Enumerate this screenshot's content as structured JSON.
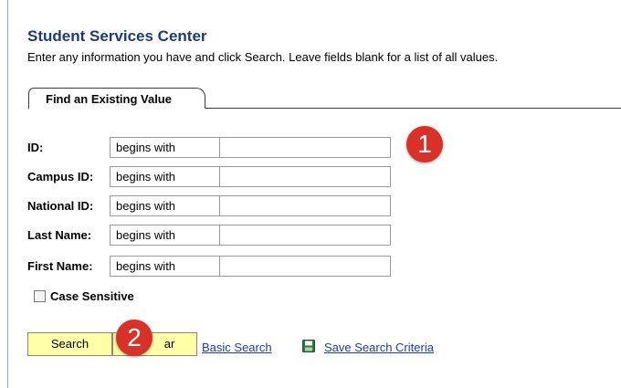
{
  "header": {
    "title": "Student Services Center",
    "subtitle": "Enter any information you have and click Search. Leave fields blank for a list of all values."
  },
  "tab": {
    "label": "Find an Existing Value"
  },
  "fields": [
    {
      "label": "ID:",
      "operator": "begins with",
      "value": ""
    },
    {
      "label": "Campus ID:",
      "operator": "begins with",
      "value": ""
    },
    {
      "label": "National ID:",
      "operator": "begins with",
      "value": ""
    },
    {
      "label": "Last Name:",
      "operator": "begins with",
      "value": ""
    },
    {
      "label": "First Name:",
      "operator": "begins with",
      "value": ""
    }
  ],
  "case_sensitive": {
    "label": "Case Sensitive",
    "checked": false
  },
  "actions": {
    "search_label": "Search",
    "clear_label": "ar",
    "basic_search_label": "Basic Search",
    "save_criteria_label": "Save Search Criteria",
    "save_icon": "save-floppy-icon"
  },
  "markers": [
    {
      "number": "1",
      "color": "#d8312a"
    },
    {
      "number": "2",
      "color": "#d8312a"
    }
  ],
  "colors": {
    "title": "#1d3c73",
    "button_bg": "#ffffa8",
    "link": "#1a3bb0"
  }
}
